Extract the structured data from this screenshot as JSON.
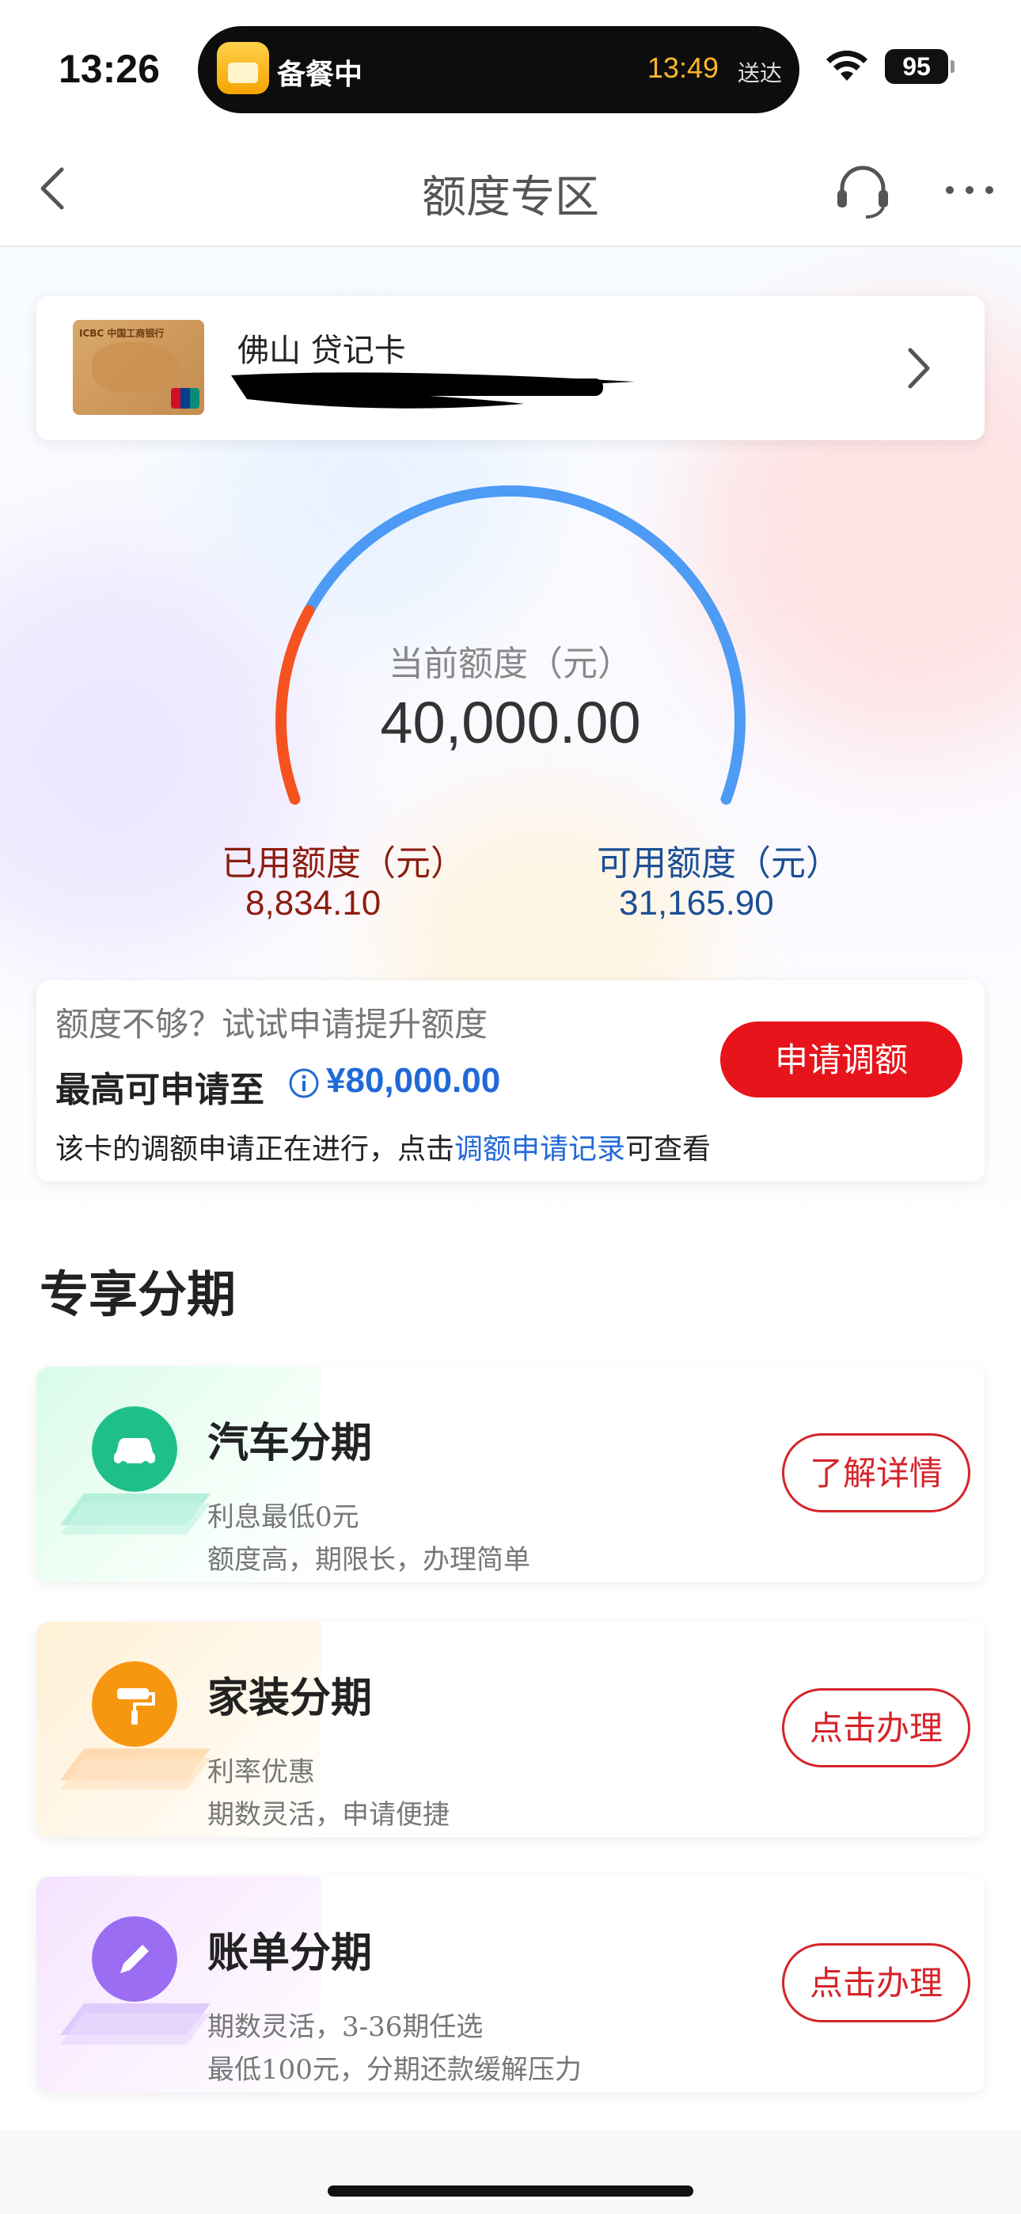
{
  "status_bar": {
    "time": "13:26",
    "live_activity": {
      "label": "备餐中",
      "eta": "13:49",
      "eta_suffix": "送达"
    },
    "battery": "95"
  },
  "nav": {
    "title": "额度专区",
    "back_icon": "chevron-left-icon",
    "service_icon": "headset-icon",
    "more_icon": "more-dots-icon"
  },
  "card": {
    "name": "佛山 贷记卡",
    "bank_text": "ICBC 中国工商银行",
    "chevron_icon": "chevron-right-icon"
  },
  "limit": {
    "current_label": "当前额度（元）",
    "current_value": "40,000.00",
    "used_label": "已用额度（元）",
    "used_value": "8,834.10",
    "available_label": "可用额度（元）",
    "available_value": "31,165.90",
    "used_fraction": 0.2209,
    "colors": {
      "used": "#f5521f",
      "available": "#4d9bf5"
    }
  },
  "boost": {
    "hint": "额度不够？试试申请提升额度",
    "max_label": "最高可申请至",
    "max_value": "¥80,000.00",
    "note_prefix": "该卡的调额申请正在进行，点击",
    "note_link": "调额申请记录",
    "note_suffix": "可查看",
    "apply_label": "申请调额"
  },
  "installments": {
    "title": "专享分期",
    "items": [
      {
        "title": "汽车分期",
        "line1": "利息最低0元",
        "line2": "额度高，期限长，办理简单",
        "button": "了解详情",
        "icon": "car-icon",
        "color": "#1fbf8a"
      },
      {
        "title": "家装分期",
        "line1": "利率优惠",
        "line2": "期数灵活，申请便捷",
        "button": "点击办理",
        "icon": "paint-roller-icon",
        "color": "#f7960f"
      },
      {
        "title": "账单分期",
        "line1": "期数灵活，3-36期任选",
        "line2": "最低100元，分期还款缓解压力",
        "button": "点击办理",
        "icon": "pencil-icon",
        "color": "#9b6df2"
      }
    ]
  }
}
